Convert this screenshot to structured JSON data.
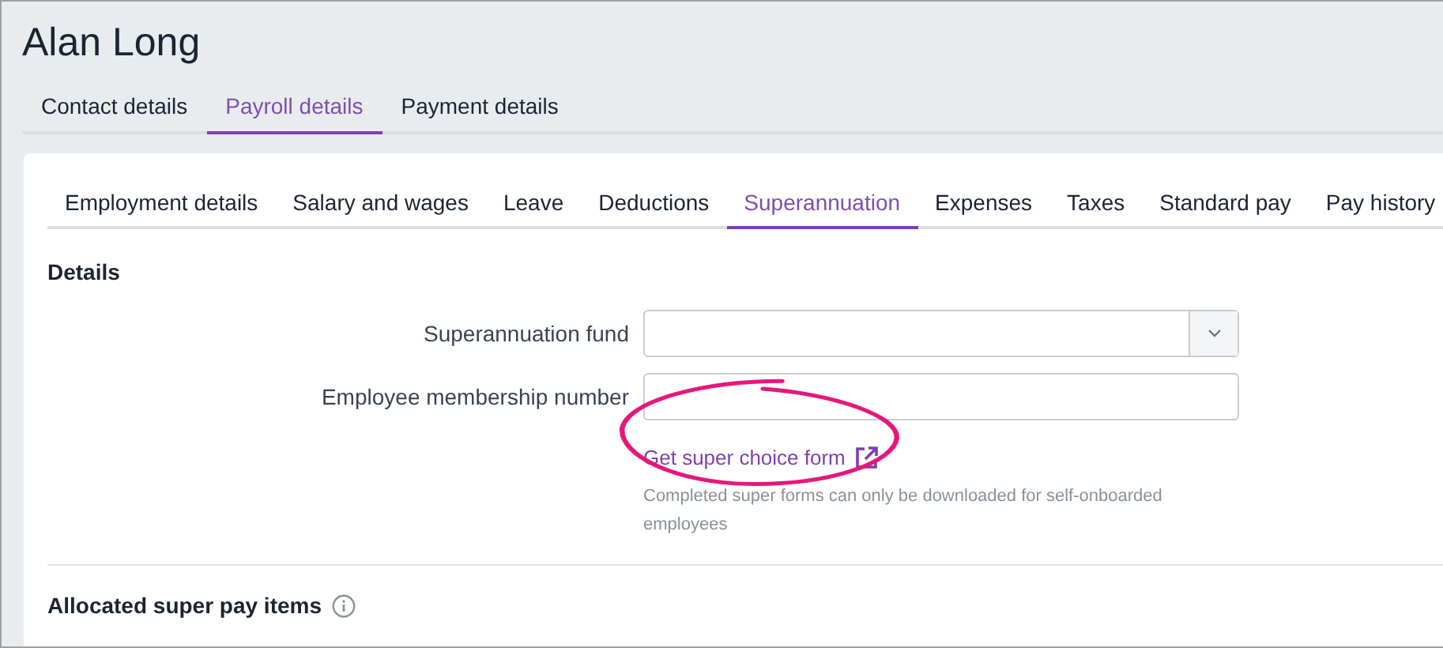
{
  "header": {
    "title": "Alan Long"
  },
  "tabs": [
    {
      "label": "Contact details",
      "selected": false
    },
    {
      "label": "Payroll details",
      "selected": true
    },
    {
      "label": "Payment details",
      "selected": false
    }
  ],
  "subtabs": [
    {
      "label": "Employment details",
      "selected": false
    },
    {
      "label": "Salary and wages",
      "selected": false
    },
    {
      "label": "Leave",
      "selected": false
    },
    {
      "label": "Deductions",
      "selected": false
    },
    {
      "label": "Superannuation",
      "selected": true
    },
    {
      "label": "Expenses",
      "selected": false
    },
    {
      "label": "Taxes",
      "selected": false
    },
    {
      "label": "Standard pay",
      "selected": false
    },
    {
      "label": "Pay history",
      "selected": false
    }
  ],
  "details": {
    "heading": "Details",
    "fields": [
      {
        "kind": "select",
        "label": "Superannuation fund"
      },
      {
        "kind": "text",
        "label": "Employee membership number"
      }
    ],
    "link": "Get super choice form",
    "help": "Completed super forms can only be downloaded for self-onboarded employees"
  },
  "allocated": {
    "heading": "Allocated super pay items"
  }
}
